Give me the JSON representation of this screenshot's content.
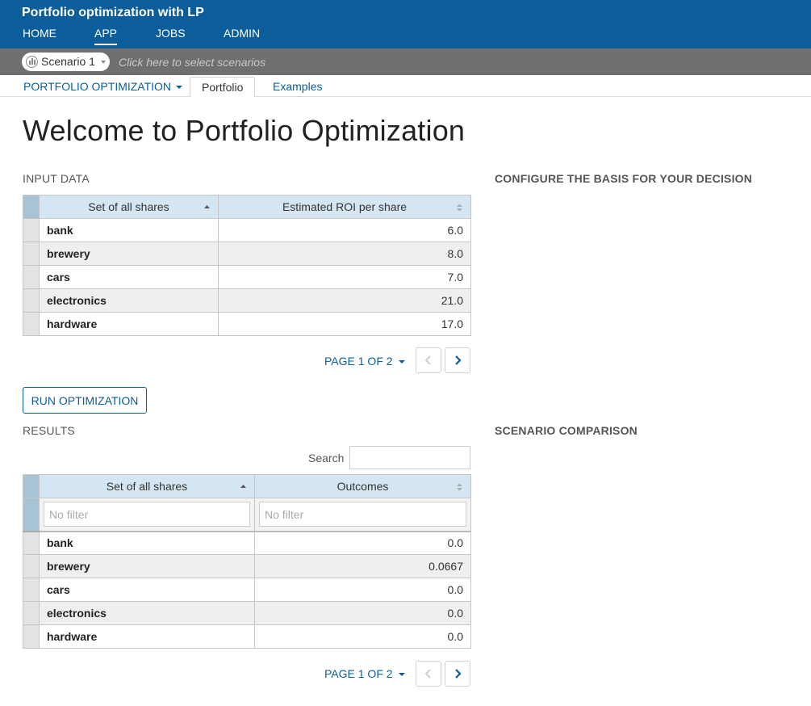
{
  "header": {
    "app_title": "Portfolio optimization with LP",
    "nav": [
      {
        "label": "HOME"
      },
      {
        "label": "APP"
      },
      {
        "label": "JOBS"
      },
      {
        "label": "ADMIN"
      }
    ],
    "active_nav": "APP"
  },
  "scenario_bar": {
    "scenario_name": "Scenario 1",
    "hint": "Click here to select scenarios"
  },
  "tabs": {
    "dropdown_label": "PORTFOLIO OPTIMIZATION",
    "items": [
      {
        "label": "Portfolio",
        "active": true
      },
      {
        "label": "Examples",
        "active": false
      }
    ]
  },
  "page": {
    "title": "Welcome to Portfolio Optimization"
  },
  "input_data": {
    "section_title": "INPUT DATA",
    "columns": [
      "Set of all shares",
      "Estimated ROI per share"
    ],
    "rows": [
      {
        "share": "bank",
        "roi": "6.0"
      },
      {
        "share": "brewery",
        "roi": "8.0"
      },
      {
        "share": "cars",
        "roi": "7.0"
      },
      {
        "share": "electronics",
        "roi": "21.0"
      },
      {
        "share": "hardware",
        "roi": "17.0"
      }
    ],
    "pager": {
      "label": "PAGE 1 OF 2"
    }
  },
  "configure": {
    "section_title": "CONFIGURE THE BASIS FOR YOUR DECISION"
  },
  "actions": {
    "run_label": "RUN OPTIMIZATION"
  },
  "results": {
    "section_title": "RESULTS",
    "search_label": "Search",
    "search_value": "",
    "columns": [
      "Set of all shares",
      "Outcomes"
    ],
    "filter_placeholder": "No filter",
    "rows": [
      {
        "share": "bank",
        "outcome": "0.0"
      },
      {
        "share": "brewery",
        "outcome": "0.0667"
      },
      {
        "share": "cars",
        "outcome": "0.0"
      },
      {
        "share": "electronics",
        "outcome": "0.0"
      },
      {
        "share": "hardware",
        "outcome": "0.0"
      }
    ],
    "pager": {
      "label": "PAGE 1 OF 2"
    }
  },
  "comparison": {
    "section_title": "SCENARIO COMPARISON"
  },
  "colors": {
    "header_blue": "#0b5e9a",
    "scenario_bar_gray": "#6f6f6f",
    "table_header_blue": "#d4e6f1",
    "row_selector_blue": "#a8c3d4"
  },
  "icons": {
    "scenario": "scenario-chart-icon",
    "sort_asc": "sort-ascending-icon",
    "sort_both": "sort-both-icon",
    "prev": "chevron-left-icon",
    "next": "chevron-right-icon"
  }
}
